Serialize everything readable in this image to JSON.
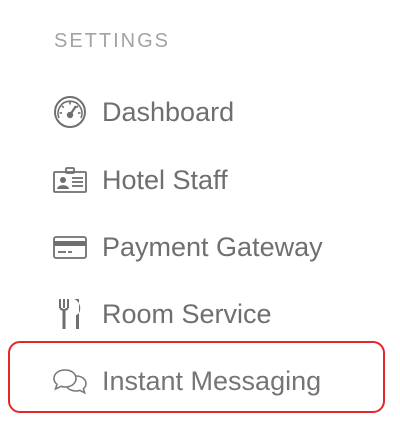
{
  "sidebar": {
    "section_title": "SETTINGS",
    "items": [
      {
        "label": "Dashboard",
        "icon": "dashboard-gauge-icon"
      },
      {
        "label": "Hotel Staff",
        "icon": "id-card-icon"
      },
      {
        "label": "Payment Gateway",
        "icon": "credit-card-icon"
      },
      {
        "label": "Room Service",
        "icon": "fork-knife-icon"
      },
      {
        "label": "Instant Messaging",
        "icon": "chat-bubbles-icon"
      }
    ]
  },
  "colors": {
    "text": "#6f6f6f",
    "section_title": "#a3a3a3",
    "highlight_border": "#e3262a"
  }
}
